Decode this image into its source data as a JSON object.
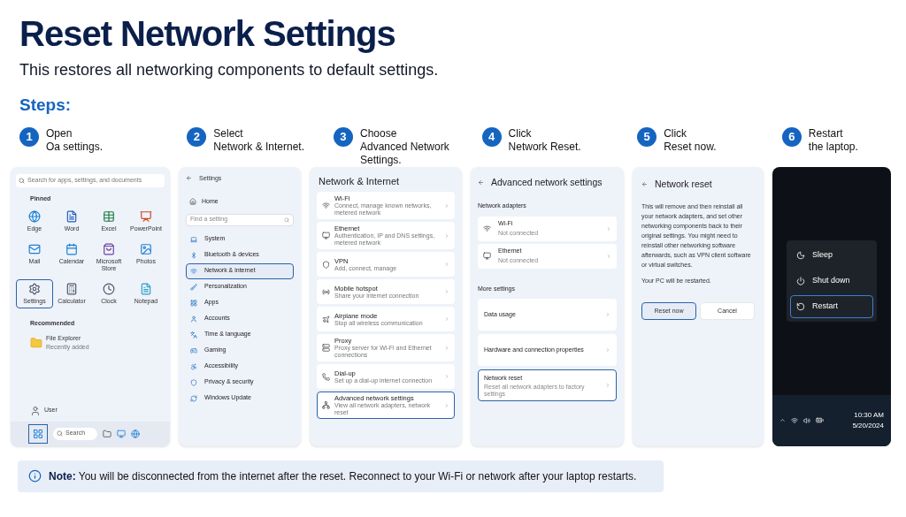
{
  "title": "Reset Network Settings",
  "subtitle": "This restores all networking components to default settings.",
  "steps_heading": "Steps:",
  "steps": [
    {
      "number": "1",
      "lines": [
        "Open",
        "Oa settings."
      ]
    },
    {
      "number": "2",
      "lines": [
        "Select",
        "Network & Internet."
      ]
    },
    {
      "number": "3",
      "lines": [
        "Choose",
        "Advanced Network",
        "Settings."
      ]
    },
    {
      "number": "4",
      "lines": [
        "Click",
        "Network Reset."
      ]
    },
    {
      "number": "5",
      "lines": [
        "Click",
        "Reset now."
      ]
    },
    {
      "number": "6",
      "lines": [
        "Restart",
        "the laptop."
      ]
    }
  ],
  "start_menu": {
    "search_placeholder": "Search for apps, settings, and documents",
    "pinned_label": "Pinned",
    "apps": [
      {
        "label": "Edge",
        "selected": false
      },
      {
        "label": "Word",
        "selected": false
      },
      {
        "label": "Excel",
        "selected": false
      },
      {
        "label": "PowerPoint",
        "selected": false
      },
      {
        "label": "Mail",
        "selected": false
      },
      {
        "label": "Calendar",
        "selected": false
      },
      {
        "label": "Microsoft Store",
        "selected": false
      },
      {
        "label": "Photos",
        "selected": false
      },
      {
        "label": "Settings",
        "selected": true
      },
      {
        "label": "Calculator",
        "selected": false
      },
      {
        "label": "Clock",
        "selected": false
      },
      {
        "label": "Notepad",
        "selected": false
      }
    ],
    "recommended_label": "Recommended",
    "recommended": {
      "name": "File Explorer",
      "detail": "Recently added"
    },
    "user": "User",
    "taskbar_search": "Search",
    "start_selected": true
  },
  "settings_nav": {
    "title": "Settings",
    "home": "Home",
    "search_placeholder": "Find a setting",
    "items": [
      {
        "label": "System",
        "selected": false
      },
      {
        "label": "Bluetooth & devices",
        "selected": false
      },
      {
        "label": "Network & internet",
        "selected": true
      },
      {
        "label": "Personalization",
        "selected": false
      },
      {
        "label": "Apps",
        "selected": false
      },
      {
        "label": "Accounts",
        "selected": false
      },
      {
        "label": "Time & language",
        "selected": false
      },
      {
        "label": "Gaming",
        "selected": false
      },
      {
        "label": "Accessibility",
        "selected": false
      },
      {
        "label": "Privacy & security",
        "selected": false
      },
      {
        "label": "Windows Update",
        "selected": false
      }
    ]
  },
  "network_internet": {
    "title": "Network & Internet",
    "items": [
      {
        "title": "Wi-Fi",
        "description": "Connect, manage known networks, metered network",
        "selected": false
      },
      {
        "title": "Ethernet",
        "description": "Authentication, IP and DNS settings, metered network",
        "selected": false
      },
      {
        "title": "VPN",
        "description": "Add, connect, manage",
        "selected": false
      },
      {
        "title": "Mobile hotspot",
        "description": "Share your internet connection",
        "selected": false
      },
      {
        "title": "Airplane mode",
        "description": "Stop all wireless communication",
        "selected": false
      },
      {
        "title": "Proxy",
        "description": "Proxy server for Wi-Fi and Ethernet connections",
        "selected": false
      },
      {
        "title": "Dial-up",
        "description": "Set up a dial-up internet connection",
        "selected": false
      },
      {
        "title": "Advanced network settings",
        "description": "View all network adapters, network reset",
        "selected": true
      }
    ]
  },
  "advanced": {
    "title": "Advanced network settings",
    "adapters_label": "Network adapters",
    "adapters": [
      {
        "title": "Wi-Fi",
        "status": "Not connected"
      },
      {
        "title": "Ethernet",
        "status": "Not connected"
      }
    ],
    "more_label": "More settings",
    "more": [
      {
        "title": "Data usage",
        "selected": false
      },
      {
        "title": "Hardware and connection properties",
        "selected": false
      },
      {
        "title": "Network reset",
        "description": "Reset all network adapters to factory settings",
        "selected": true
      }
    ]
  },
  "network_reset": {
    "title": "Network reset",
    "body": "This will remove and then reinstall all your network adapters, and set other networking components back to their original settings. You might need to reinstall other networking software afterwards, such as VPN client software or virtual switches.",
    "restart_note": "Your PC will be restarted.",
    "buttons": [
      {
        "label": "Reset now",
        "selected": true
      },
      {
        "label": "Cancel",
        "selected": false
      }
    ]
  },
  "power_menu": {
    "items": [
      {
        "label": "Sleep",
        "selected": false
      },
      {
        "label": "Shut down",
        "selected": false
      },
      {
        "label": "Restart",
        "selected": true
      }
    ],
    "time": "10:30 AM",
    "date": "5/20/2024"
  },
  "note": {
    "label": "Note:",
    "text": "You will be disconnected from the internet after the reset. Reconnect to your Wi-Fi or network after your laptop restarts."
  }
}
